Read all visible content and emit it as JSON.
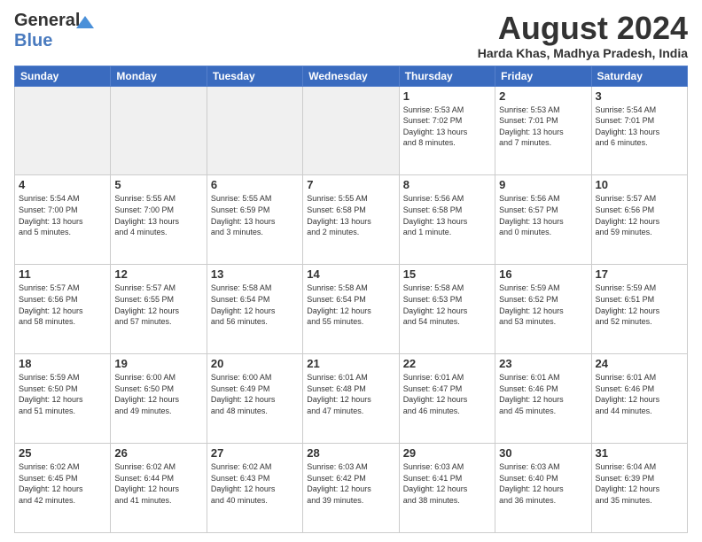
{
  "logo": {
    "text1": "General",
    "text2": "Blue"
  },
  "title": {
    "month_year": "August 2024",
    "location": "Harda Khas, Madhya Pradesh, India"
  },
  "days_of_week": [
    "Sunday",
    "Monday",
    "Tuesday",
    "Wednesday",
    "Thursday",
    "Friday",
    "Saturday"
  ],
  "weeks": [
    [
      {
        "day": "",
        "info": ""
      },
      {
        "day": "",
        "info": ""
      },
      {
        "day": "",
        "info": ""
      },
      {
        "day": "",
        "info": ""
      },
      {
        "day": "1",
        "info": "Sunrise: 5:53 AM\nSunset: 7:02 PM\nDaylight: 13 hours\nand 8 minutes."
      },
      {
        "day": "2",
        "info": "Sunrise: 5:53 AM\nSunset: 7:01 PM\nDaylight: 13 hours\nand 7 minutes."
      },
      {
        "day": "3",
        "info": "Sunrise: 5:54 AM\nSunset: 7:01 PM\nDaylight: 13 hours\nand 6 minutes."
      }
    ],
    [
      {
        "day": "4",
        "info": "Sunrise: 5:54 AM\nSunset: 7:00 PM\nDaylight: 13 hours\nand 5 minutes."
      },
      {
        "day": "5",
        "info": "Sunrise: 5:55 AM\nSunset: 7:00 PM\nDaylight: 13 hours\nand 4 minutes."
      },
      {
        "day": "6",
        "info": "Sunrise: 5:55 AM\nSunset: 6:59 PM\nDaylight: 13 hours\nand 3 minutes."
      },
      {
        "day": "7",
        "info": "Sunrise: 5:55 AM\nSunset: 6:58 PM\nDaylight: 13 hours\nand 2 minutes."
      },
      {
        "day": "8",
        "info": "Sunrise: 5:56 AM\nSunset: 6:58 PM\nDaylight: 13 hours\nand 1 minute."
      },
      {
        "day": "9",
        "info": "Sunrise: 5:56 AM\nSunset: 6:57 PM\nDaylight: 13 hours\nand 0 minutes."
      },
      {
        "day": "10",
        "info": "Sunrise: 5:57 AM\nSunset: 6:56 PM\nDaylight: 12 hours\nand 59 minutes."
      }
    ],
    [
      {
        "day": "11",
        "info": "Sunrise: 5:57 AM\nSunset: 6:56 PM\nDaylight: 12 hours\nand 58 minutes."
      },
      {
        "day": "12",
        "info": "Sunrise: 5:57 AM\nSunset: 6:55 PM\nDaylight: 12 hours\nand 57 minutes."
      },
      {
        "day": "13",
        "info": "Sunrise: 5:58 AM\nSunset: 6:54 PM\nDaylight: 12 hours\nand 56 minutes."
      },
      {
        "day": "14",
        "info": "Sunrise: 5:58 AM\nSunset: 6:54 PM\nDaylight: 12 hours\nand 55 minutes."
      },
      {
        "day": "15",
        "info": "Sunrise: 5:58 AM\nSunset: 6:53 PM\nDaylight: 12 hours\nand 54 minutes."
      },
      {
        "day": "16",
        "info": "Sunrise: 5:59 AM\nSunset: 6:52 PM\nDaylight: 12 hours\nand 53 minutes."
      },
      {
        "day": "17",
        "info": "Sunrise: 5:59 AM\nSunset: 6:51 PM\nDaylight: 12 hours\nand 52 minutes."
      }
    ],
    [
      {
        "day": "18",
        "info": "Sunrise: 5:59 AM\nSunset: 6:50 PM\nDaylight: 12 hours\nand 51 minutes."
      },
      {
        "day": "19",
        "info": "Sunrise: 6:00 AM\nSunset: 6:50 PM\nDaylight: 12 hours\nand 49 minutes."
      },
      {
        "day": "20",
        "info": "Sunrise: 6:00 AM\nSunset: 6:49 PM\nDaylight: 12 hours\nand 48 minutes."
      },
      {
        "day": "21",
        "info": "Sunrise: 6:01 AM\nSunset: 6:48 PM\nDaylight: 12 hours\nand 47 minutes."
      },
      {
        "day": "22",
        "info": "Sunrise: 6:01 AM\nSunset: 6:47 PM\nDaylight: 12 hours\nand 46 minutes."
      },
      {
        "day": "23",
        "info": "Sunrise: 6:01 AM\nSunset: 6:46 PM\nDaylight: 12 hours\nand 45 minutes."
      },
      {
        "day": "24",
        "info": "Sunrise: 6:01 AM\nSunset: 6:46 PM\nDaylight: 12 hours\nand 44 minutes."
      }
    ],
    [
      {
        "day": "25",
        "info": "Sunrise: 6:02 AM\nSunset: 6:45 PM\nDaylight: 12 hours\nand 42 minutes."
      },
      {
        "day": "26",
        "info": "Sunrise: 6:02 AM\nSunset: 6:44 PM\nDaylight: 12 hours\nand 41 minutes."
      },
      {
        "day": "27",
        "info": "Sunrise: 6:02 AM\nSunset: 6:43 PM\nDaylight: 12 hours\nand 40 minutes."
      },
      {
        "day": "28",
        "info": "Sunrise: 6:03 AM\nSunset: 6:42 PM\nDaylight: 12 hours\nand 39 minutes."
      },
      {
        "day": "29",
        "info": "Sunrise: 6:03 AM\nSunset: 6:41 PM\nDaylight: 12 hours\nand 38 minutes."
      },
      {
        "day": "30",
        "info": "Sunrise: 6:03 AM\nSunset: 6:40 PM\nDaylight: 12 hours\nand 36 minutes."
      },
      {
        "day": "31",
        "info": "Sunrise: 6:04 AM\nSunset: 6:39 PM\nDaylight: 12 hours\nand 35 minutes."
      }
    ]
  ]
}
